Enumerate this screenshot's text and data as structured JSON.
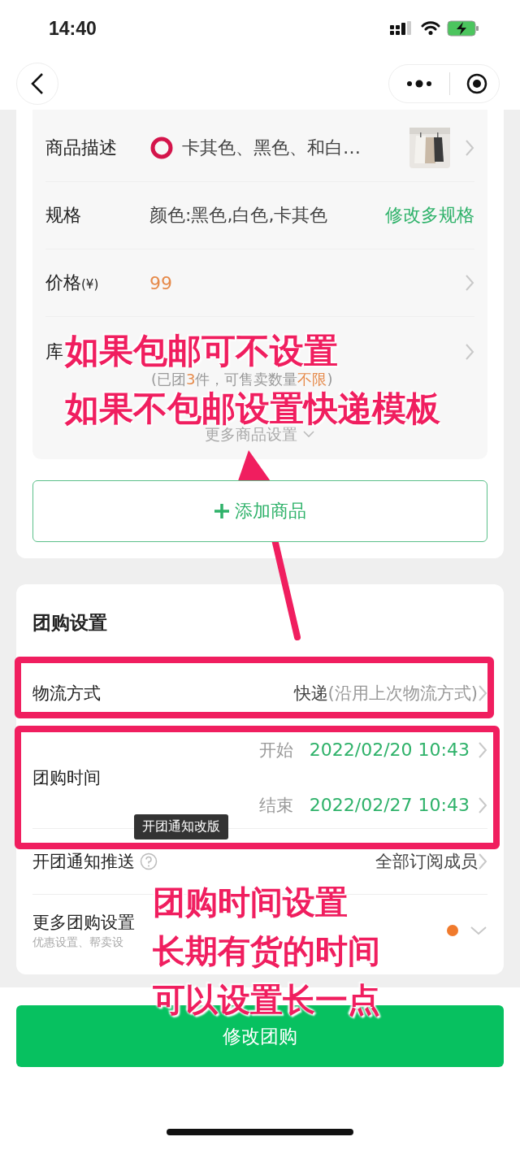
{
  "status_bar": {
    "time": "14:40"
  },
  "product": {
    "rows": [
      {
        "kind": "description",
        "label": "商品描述",
        "value": "卡其色、黑色、和白…"
      },
      {
        "kind": "spec",
        "label": "规格",
        "value": "颜色:黑色,白色,卡其色",
        "action": "修改多规格"
      },
      {
        "kind": "price",
        "label": "价格",
        "unit": "(¥)",
        "value": "99"
      },
      {
        "kind": "stock",
        "label": "库",
        "note": [
          {
            "text": "(已团",
            "accent": false
          },
          {
            "text": "3",
            "accent": true
          },
          {
            "text": "件，可售卖数量",
            "accent": false
          },
          {
            "text": "不限",
            "accent": true
          },
          {
            "text": ")",
            "accent": false
          }
        ]
      }
    ],
    "more_settings": "更多商品设置",
    "add_button": "添加商品"
  },
  "group_settings": {
    "title": "团购设置",
    "rows": [
      {
        "kind": "logistics",
        "label": "物流方式",
        "value": "快递",
        "note": "(沿用上次物流方式)"
      },
      {
        "kind": "time",
        "label": "团购时间",
        "start_label": "开始",
        "start_value": "2022/02/20 10:43",
        "end_label": "结束",
        "end_value": "2022/02/27 10:43"
      },
      {
        "kind": "notify",
        "label": "开团通知推送",
        "value": "全部订阅成员",
        "tooltip": "开团通知改版"
      },
      {
        "kind": "more",
        "label": "更多团购设置",
        "sub": "优惠设置、帮卖设",
        "dot": true
      }
    ]
  },
  "submit_button": "修改团购",
  "annotations": [
    {
      "lines": [
        "如果包邮可不设置",
        "如果不包邮设置快递模板"
      ]
    },
    {
      "lines": [
        "团购时间设置",
        "长期有货的时间",
        "可以设置长一点"
      ]
    }
  ]
}
